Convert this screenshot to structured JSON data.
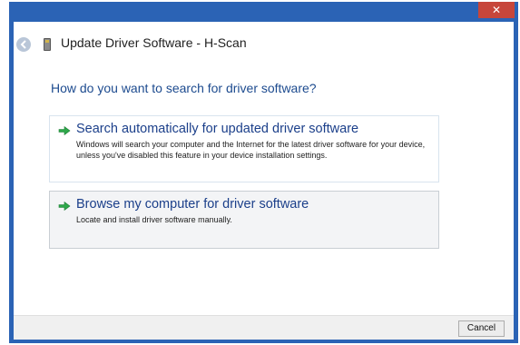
{
  "window": {
    "title": "Update Driver Software - H-Scan",
    "close_label": "✕",
    "accent_color": "#2b63b5"
  },
  "header": {
    "back_icon": "back-arrow-icon",
    "device_icon": "usb-device-icon"
  },
  "main": {
    "question": "How do you want to search for driver software?",
    "options": [
      {
        "icon": "green-arrow-icon",
        "title": "Search automatically for updated driver software",
        "description": "Windows will search your computer and the Internet for the latest driver software for your device, unless you've disabled this feature in your device installation settings."
      },
      {
        "icon": "green-arrow-icon",
        "title": "Browse my computer for driver software",
        "description": "Locate and install driver software manually."
      }
    ]
  },
  "footer": {
    "cancel_label": "Cancel"
  }
}
